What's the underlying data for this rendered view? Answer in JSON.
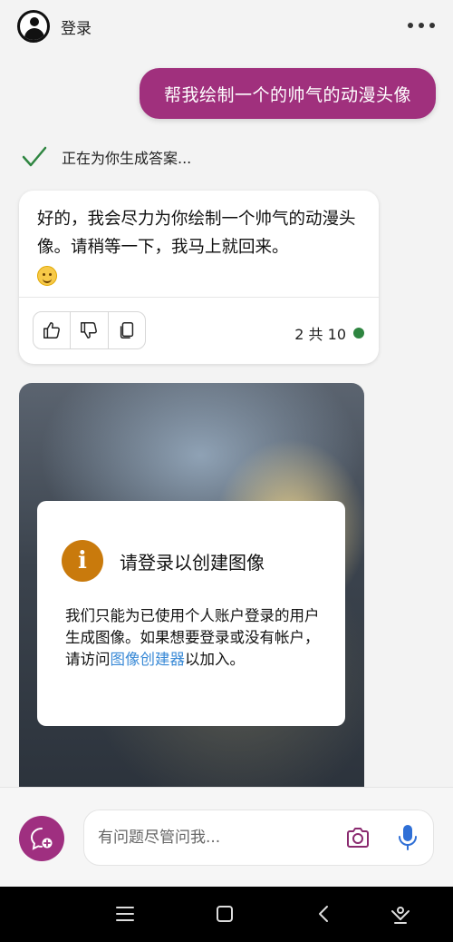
{
  "header": {
    "login_label": "登录",
    "avatar_icon": "user-avatar-icon",
    "more_icon": "more-horizontal-icon"
  },
  "conversation": {
    "user_message": "帮我绘制一个的帅气的动漫头像",
    "status_text": "正在为你生成答案...",
    "reply": {
      "text": "好的，我会尽力为你绘制一个帅气的动漫头像。请稍等一下，我马上就回来。",
      "emoji": "smiling-face",
      "actions": [
        "thumbs-up-icon",
        "thumbs-down-icon",
        "copy-icon"
      ],
      "count_text": "2 共 10",
      "status_color": "#2e8540"
    },
    "image_card": {
      "dialog_title": "请登录以创建图像",
      "dialog_body_before": "我们只能为已使用个人账户登录的用户生成图像。如果想要登录或没有帐户，请访问",
      "dialog_link": "图像创建器",
      "dialog_body_after": "以加入。",
      "info_icon_glyph": "i"
    }
  },
  "composer": {
    "placeholder": "有问题尽管问我...",
    "new_topic_icon": "new-topic-icon",
    "camera_icon": "camera-icon",
    "mic_icon": "microphone-icon"
  },
  "colors": {
    "accent": "#a0307d",
    "link": "#3a8ad6",
    "info": "#c97a0c",
    "check": "#2e8540"
  },
  "system_nav": [
    "menu-icon",
    "home-icon",
    "back-icon",
    "assistant-icon"
  ]
}
